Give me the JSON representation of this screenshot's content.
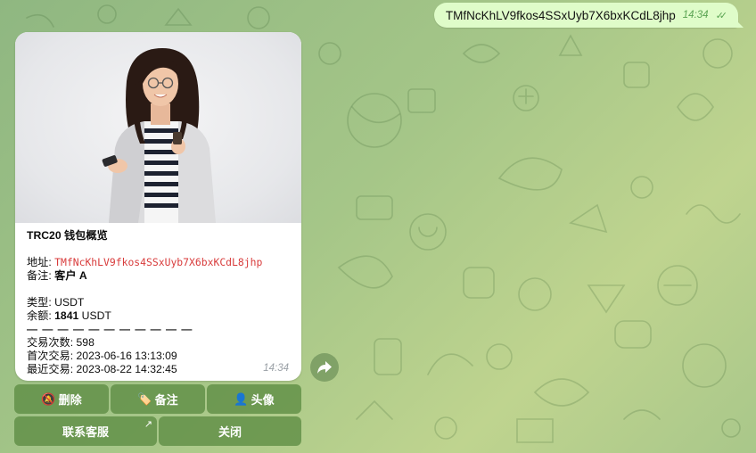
{
  "outgoing": {
    "text": "TMfNcKhLV9fkos4SSxUyb7X6bxKCdL8jhp",
    "time": "14:34",
    "status_icon": "double-check-icon"
  },
  "card": {
    "image_alt_icon": "businesswoman-photo",
    "title": "TRC20 钱包概览",
    "address_label": "地址: ",
    "address_value": "TMfNcKhLV9fkos4SSxUyb7X6bxKCdL8jhp",
    "note_label": "备注: ",
    "note_value": "客户 A",
    "type_label": "类型: ",
    "type_value": "USDT",
    "balance_label": "余额: ",
    "balance_value": "1841",
    "balance_unit": " USDT",
    "divider": "— — — — — — — — — — —",
    "tx_count_label": "交易次数: ",
    "tx_count_value": "598",
    "first_tx_label": "首次交易: ",
    "first_tx_value": "2023-06-16 13:13:09",
    "last_tx_label": "最近交易: ",
    "last_tx_value": "2023-08-22 14:32:45",
    "time": "14:34",
    "address_color": "#d83b3b"
  },
  "forward_icon": "forward-arrow-icon",
  "keyboard": {
    "row1": [
      {
        "icon": "🔕",
        "icon_name": "mute-bell-icon",
        "label": "删除"
      },
      {
        "icon": "🏷️",
        "icon_name": "tag-icon",
        "label": "备注"
      },
      {
        "icon": "👤",
        "icon_name": "user-silhouette-icon",
        "label": "头像"
      }
    ],
    "row2": [
      {
        "label": "联系客服",
        "corner_icon": "↗",
        "icon_name": "external-link-arrow-icon"
      },
      {
        "label": "关闭"
      }
    ]
  },
  "colors": {
    "chat_bg": "#a5c688",
    "outgoing_bubble": "#dffcc9",
    "keyboard_button": "#5c8c42"
  }
}
